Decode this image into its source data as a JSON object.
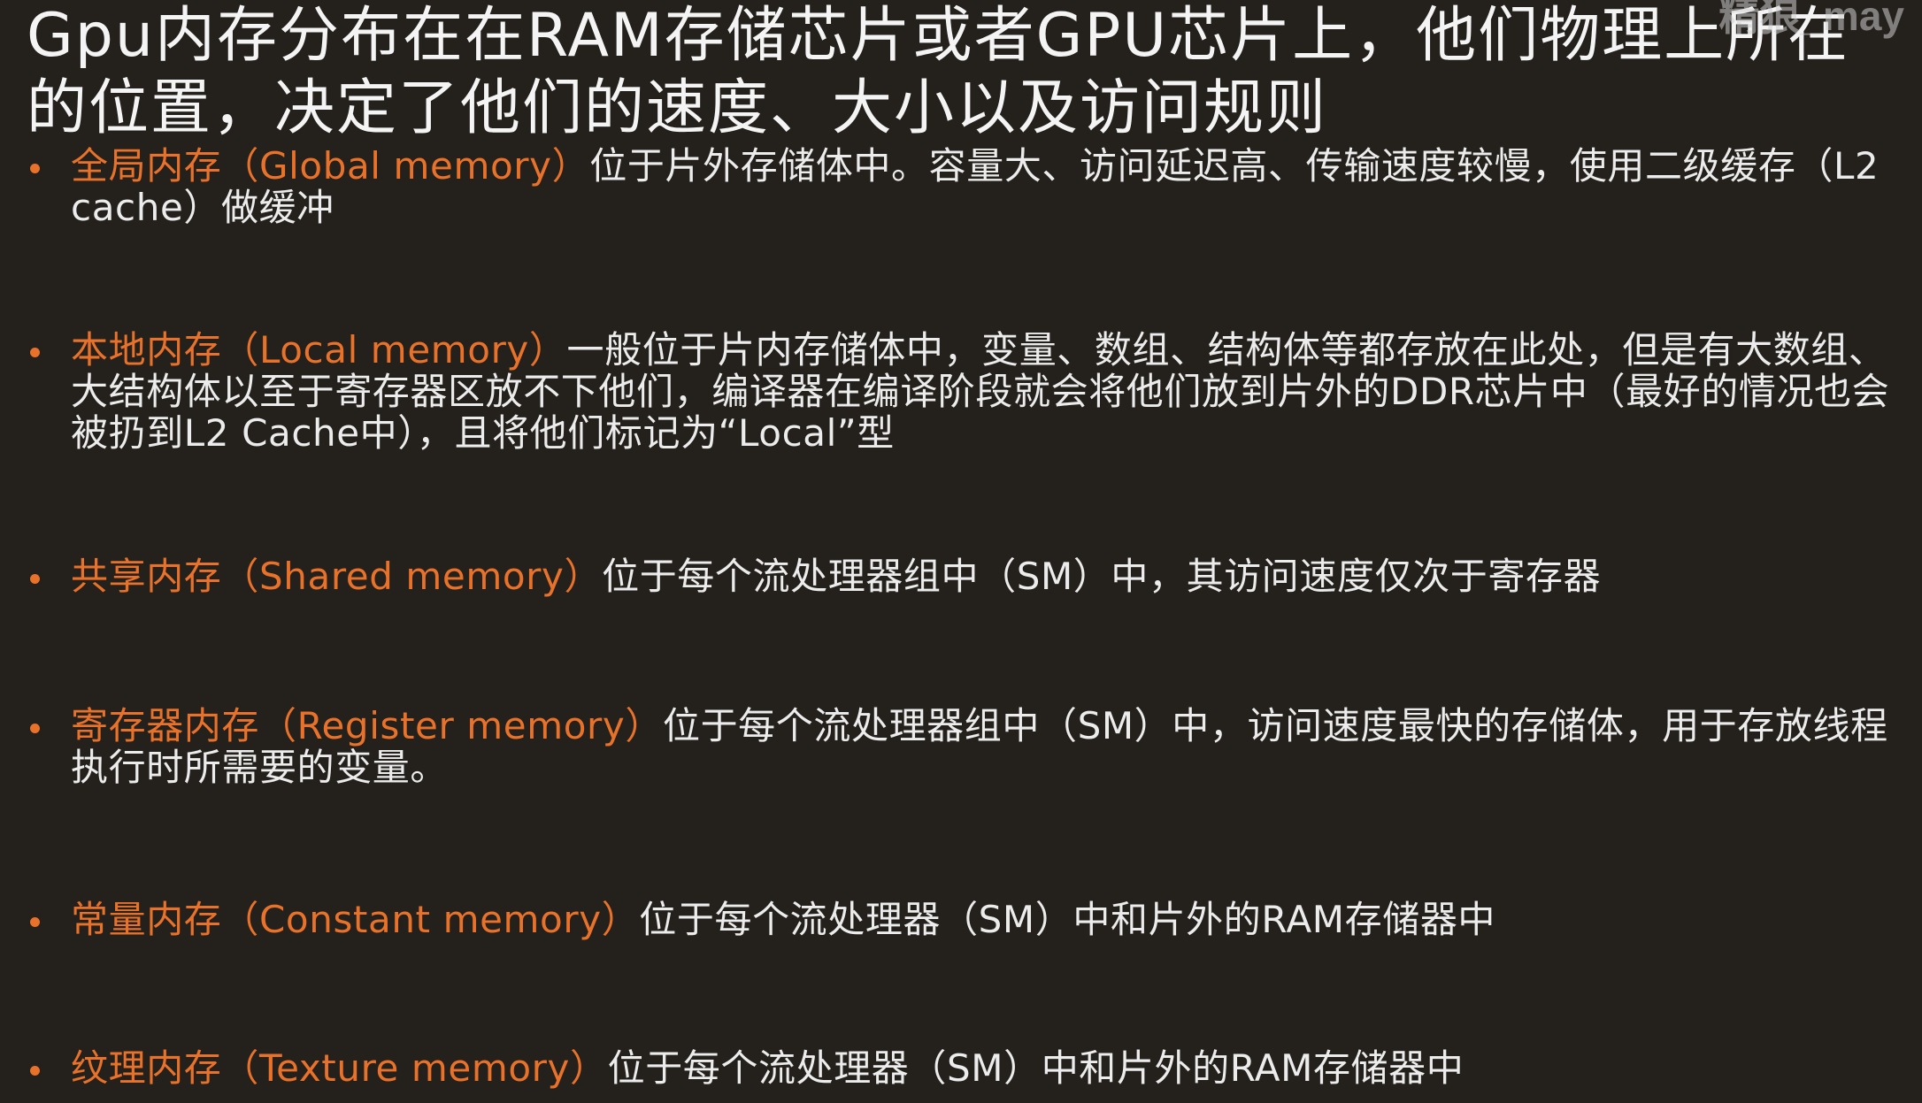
{
  "slide": {
    "title": "Gpu内存分布在在RAM存储芯片或者GPU芯片上，他们物理上所在\n的位置，决定了他们的速度、大小以及访问规则",
    "watermark": "精狼_may",
    "bullets": [
      {
        "term": "全局内存（Global memory）",
        "description": "位于片外存储体中。容量大、访问延迟高、传输速度较慢，使用二级缓存（L2 cache）做缓冲"
      },
      {
        "term": "本地内存（Local memory）",
        "description": "一般位于片内存储体中，变量、数组、结构体等都存放在此处，但是有大数组、大结构体以至于寄存器区放不下他们，编译器在编译阶段就会将他们放到片外的DDR芯片中（最好的情况也会被扔到L2 Cache中），且将他们标记为“Local”型"
      },
      {
        "term": "共享内存（Shared memory）",
        "description": "位于每个流处理器组中（SM）中，其访问速度仅次于寄存器"
      },
      {
        "term": "寄存器内存（Register memory）",
        "description": "位于每个流处理器组中（SM）中，访问速度最快的存储体，用于存放线程执行时所需要的变量。"
      },
      {
        "term": "常量内存（Constant memory）",
        "description": "位于每个流处理器（SM）中和片外的RAM存储器中"
      },
      {
        "term": "纹理内存（Texture memory）",
        "description": "位于每个流处理器（SM）中和片外的RAM存储器中"
      }
    ]
  }
}
